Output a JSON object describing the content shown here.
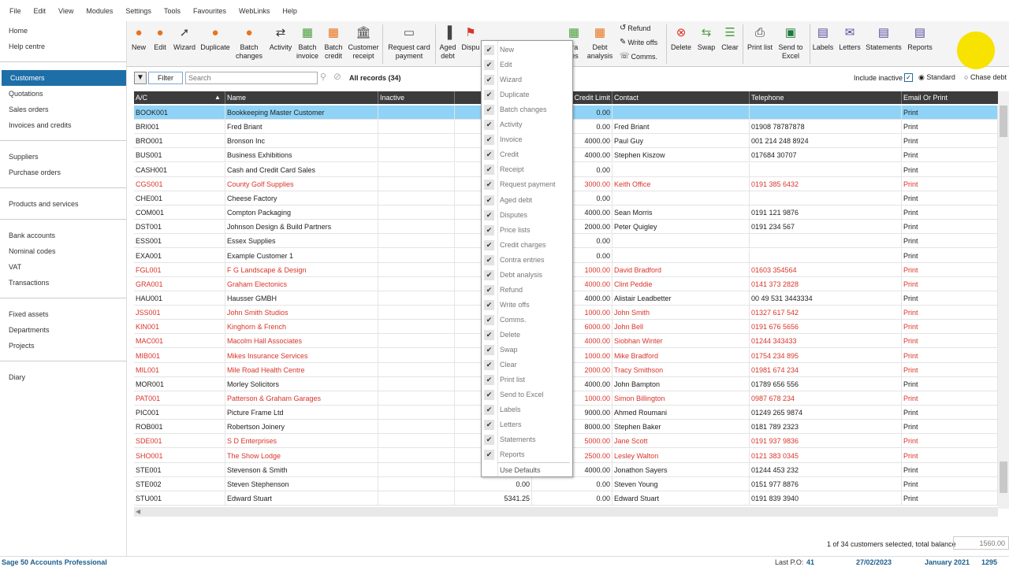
{
  "menu": [
    "File",
    "Edit",
    "View",
    "Modules",
    "Settings",
    "Tools",
    "Favourites",
    "WebLinks",
    "Help"
  ],
  "sidebar": {
    "groups": [
      [
        "Home",
        "Help centre"
      ],
      [
        "Customers",
        "Quotations",
        "Sales orders",
        "Invoices and credits"
      ],
      [
        "Suppliers",
        "Purchase orders"
      ],
      [
        "Products and services"
      ],
      [
        "Bank accounts",
        "Nominal codes",
        "VAT",
        "Transactions"
      ],
      [
        "Fixed assets",
        "Departments",
        "Projects"
      ],
      [
        "Diary"
      ]
    ],
    "active": "Customers"
  },
  "toolbar": {
    "new": "New",
    "edit": "Edit",
    "wizard": "Wizard",
    "duplicate": "Duplicate",
    "batch_changes": "Batch changes",
    "activity": "Activity",
    "batch_invoice": "Batch invoice",
    "batch_credit": "Batch credit",
    "customer_receipt": "Customer receipt",
    "request_card_payment": "Request card payment",
    "aged_debt": "Aged debt",
    "disputes": "Dispu",
    "contra_partial": "tra",
    "contra_partial2": "ies",
    "debt_analysis": "Debt analysis",
    "refund": "Refund",
    "write_offs": "Write offs",
    "comms": "Comms.",
    "delete": "Delete",
    "swap": "Swap",
    "clear": "Clear",
    "print_list": "Print list",
    "send_to_excel": "Send to Excel",
    "labels": "Labels",
    "letters": "Letters",
    "statements": "Statements",
    "reports": "Reports"
  },
  "filterbar": {
    "filter_label": "Filter",
    "search_placeholder": "Search",
    "records": "All records (34)",
    "include_inactive": "Include inactive",
    "standard": "Standard",
    "chase_debt": "Chase debt"
  },
  "columns": {
    "ac": "A/C",
    "name": "Name",
    "inactive": "Inactive",
    "credit_limit": "Credit Limit",
    "contact": "Contact",
    "telephone": "Telephone",
    "email_or_print": "Email Or Print"
  },
  "rows": [
    {
      "ac": "BOOK001",
      "name": "Bookkeeping Master Customer",
      "bal": "",
      "cl": "0.00",
      "contact": "",
      "tel": "",
      "ep": "Print",
      "red": false,
      "sel": true
    },
    {
      "ac": "BRI001",
      "name": "Fred Briant",
      "bal": "",
      "cl": "0.00",
      "contact": "Fred Briant",
      "tel": "01908 78787878",
      "ep": "Print",
      "red": false
    },
    {
      "ac": "BRO001",
      "name": "Bronson Inc",
      "bal": "",
      "cl": "4000.00",
      "contact": "Paul Guy",
      "tel": "001 214 248 8924",
      "ep": "Print",
      "red": false
    },
    {
      "ac": "BUS001",
      "name": "Business Exhibitions",
      "bal": "",
      "cl": "4000.00",
      "contact": "Stephen Kiszow",
      "tel": "017684 30707",
      "ep": "Print",
      "red": false
    },
    {
      "ac": "CASH001",
      "name": "Cash and Credit Card Sales",
      "bal": "",
      "cl": "0.00",
      "contact": "",
      "tel": "",
      "ep": "Print",
      "red": false
    },
    {
      "ac": "CGS001",
      "name": "County Golf Supplies",
      "bal": "",
      "cl": "3000.00",
      "contact": "Keith Office",
      "tel": "0191 385 6432",
      "ep": "Print",
      "red": true
    },
    {
      "ac": "CHE001",
      "name": "Cheese Factory",
      "bal": "",
      "cl": "0.00",
      "contact": "",
      "tel": "",
      "ep": "Print",
      "red": false
    },
    {
      "ac": "COM001",
      "name": "Compton Packaging",
      "bal": "",
      "cl": "4000.00",
      "contact": "Sean Morris",
      "tel": "0191 121 9876",
      "ep": "Print",
      "red": false
    },
    {
      "ac": "DST001",
      "name": "Johnson Design & Build Partners",
      "bal": "",
      "cl": "2000.00",
      "contact": "Peter Quigley",
      "tel": "0191 234 567",
      "ep": "Print",
      "red": false
    },
    {
      "ac": "ESS001",
      "name": "Essex Supplies",
      "bal": "",
      "cl": "0.00",
      "contact": "",
      "tel": "",
      "ep": "Print",
      "red": false
    },
    {
      "ac": "EXA001",
      "name": "Example Customer 1",
      "bal": "",
      "cl": "0.00",
      "contact": "",
      "tel": "",
      "ep": "Print",
      "red": false
    },
    {
      "ac": "FGL001",
      "name": "F G Landscape & Design",
      "bal": "",
      "cl": "1000.00",
      "contact": "David Bradford",
      "tel": "01603 354564",
      "ep": "Print",
      "red": true
    },
    {
      "ac": "GRA001",
      "name": "Graham Electonics",
      "bal": "",
      "cl": "4000.00",
      "contact": "Clint Peddie",
      "tel": "0141 373 2828",
      "ep": "Print",
      "red": true
    },
    {
      "ac": "HAU001",
      "name": "Hausser GMBH",
      "bal": "",
      "cl": "4000.00",
      "contact": "Alistair Leadbetter",
      "tel": "00 49 531 3443334",
      "ep": "Print",
      "red": false
    },
    {
      "ac": "JSS001",
      "name": "John Smith Studios",
      "bal": "",
      "cl": "1000.00",
      "contact": "John Smith",
      "tel": "01327 617 542",
      "ep": "Print",
      "red": true
    },
    {
      "ac": "KIN001",
      "name": "Kinghorn & French",
      "bal": "",
      "cl": "6000.00",
      "contact": "John Bell",
      "tel": "0191 676 5656",
      "ep": "Print",
      "red": true
    },
    {
      "ac": "MAC001",
      "name": "Macolm Hall Associates",
      "bal": "",
      "cl": "4000.00",
      "contact": "Siobhan Winter",
      "tel": "01244 343433",
      "ep": "Print",
      "red": true
    },
    {
      "ac": "MIB001",
      "name": "Mikes Insurance Services",
      "bal": "",
      "cl": "1000.00",
      "contact": "Mike Bradford",
      "tel": "01754 234 895",
      "ep": "Print",
      "red": true
    },
    {
      "ac": "MIL001",
      "name": "Mile Road Health Centre",
      "bal": "",
      "cl": "2000.00",
      "contact": "Tracy Smithson",
      "tel": "01981 674 234",
      "ep": "Print",
      "red": true
    },
    {
      "ac": "MOR001",
      "name": "Morley Solicitors",
      "bal": "",
      "cl": "4000.00",
      "contact": "John Bampton",
      "tel": "01789 656 556",
      "ep": "Print",
      "red": false
    },
    {
      "ac": "PAT001",
      "name": "Patterson & Graham Garages",
      "bal": "",
      "cl": "1000.00",
      "contact": "Simon Billington",
      "tel": "0987 678 234",
      "ep": "Print",
      "red": true
    },
    {
      "ac": "PIC001",
      "name": "Picture Frame Ltd",
      "bal": "",
      "cl": "9000.00",
      "contact": "Ahmed Roumani",
      "tel": "01249 265 9874",
      "ep": "Print",
      "red": false
    },
    {
      "ac": "ROB001",
      "name": "Robertson Joinery",
      "bal": "",
      "cl": "8000.00",
      "contact": "Stephen Baker",
      "tel": "0181 789 2323",
      "ep": "Print",
      "red": false
    },
    {
      "ac": "SDE001",
      "name": "S D Enterprises",
      "bal": "",
      "cl": "5000.00",
      "contact": "Jane Scott",
      "tel": "0191 937 9836",
      "ep": "Print",
      "red": true
    },
    {
      "ac": "SHO001",
      "name": "The Show Lodge",
      "bal": "",
      "cl": "2500.00",
      "contact": "Lesley Walton",
      "tel": "0121 383 0345",
      "ep": "Print",
      "red": true
    },
    {
      "ac": "STE001",
      "name": "Stevenson & Smith",
      "bal": "",
      "cl": "4000.00",
      "contact": "Jonathon Sayers",
      "tel": "01244 453 232",
      "ep": "Print",
      "red": false
    },
    {
      "ac": "STE002",
      "name": "Steven Stephenson",
      "bal": "0.00",
      "cl": "0.00",
      "contact": "Steven Young",
      "tel": "0151 977 8876",
      "ep": "Print",
      "red": false
    },
    {
      "ac": "STU001",
      "name": "Edward Stuart",
      "bal": "5341.25",
      "cl": "0.00",
      "contact": "Edward Stuart",
      "tel": "0191 839 3940",
      "ep": "Print",
      "red": false
    }
  ],
  "popup_items": [
    "New",
    "Edit",
    "Wizard",
    "Duplicate",
    "Batch changes",
    "Activity",
    "Invoice",
    "Credit",
    "Receipt",
    "Request payment",
    "Aged debt",
    "Disputes",
    "Price lists",
    "Credit charges",
    "Contra entries",
    "Debt analysis",
    "Refund",
    "Write offs",
    "Comms.",
    "Delete",
    "Swap",
    "Clear",
    "Print list",
    "Send to Excel",
    "Labels",
    "Letters",
    "Statements",
    "Reports"
  ],
  "popup_default": "Use Defaults",
  "footer": {
    "selection": "1 of 34 customers selected, total balance",
    "total_balance": "1560.00"
  },
  "status": {
    "app": "Sage 50 Accounts Professional",
    "last_po_label": "Last P.O:",
    "last_po": "41",
    "date": "27/02/2023",
    "period": "January 2021",
    "num": "1295"
  },
  "colors": {
    "accent": "#1e6fa8",
    "selected_row": "#8fd3f7",
    "overdue_text": "#d9352a",
    "header_bg": "#3c3c3c"
  }
}
